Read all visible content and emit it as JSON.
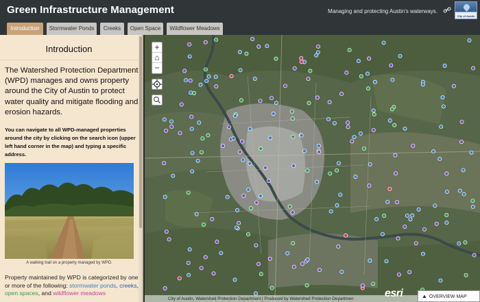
{
  "app": {
    "title": "Green Infrastructure Management",
    "subtitle": "Managing and protecting Austin's waterways.",
    "logo_text": "City of Austin"
  },
  "tabs": [
    {
      "label": "Introduction",
      "active": true
    },
    {
      "label": "Stormwater Ponds",
      "active": false
    },
    {
      "label": "Creeks",
      "active": false
    },
    {
      "label": "Open Space",
      "active": false
    },
    {
      "label": "Wildflower Meadows",
      "active": false
    }
  ],
  "panel": {
    "title": "Introduction",
    "lead": "The Watershed Protection Department (WPD) manages and owns property around the City of Austin to protect water quality and mitigate flooding and erosion hazards.",
    "nav_note": "You can navigate to all WPD-managed properties around the city by clicking on the search icon (upper left hand corner in the map) and typing a specific address.",
    "photo_caption": "A walking trail on a property managed by WPD.",
    "category_intro": "Property maintained by WPD is categorized by one or more of the following: ",
    "categories": {
      "stormwater": "stormwater ponds",
      "creeks": "creeks",
      "open": "open spaces",
      "and": ", and ",
      "wild": "wildflower meadows"
    }
  },
  "map": {
    "controls": {
      "zoom_in": "+",
      "home": "⌂",
      "zoom_out": "−"
    },
    "attribution": "City of Austin, Watershed Protection Department | Produced by Watershed Protection Departmen",
    "esri": "esri",
    "overview_label": "OVERVIEW MAP"
  },
  "colors": {
    "header": "#303538",
    "tab_active": "#c9a27a",
    "panel_bg": "#f5e6cf",
    "pond": "#3a7fc4",
    "creek": "#7a50c0",
    "open": "#2aa24a",
    "meadow": "#d23a6a"
  }
}
